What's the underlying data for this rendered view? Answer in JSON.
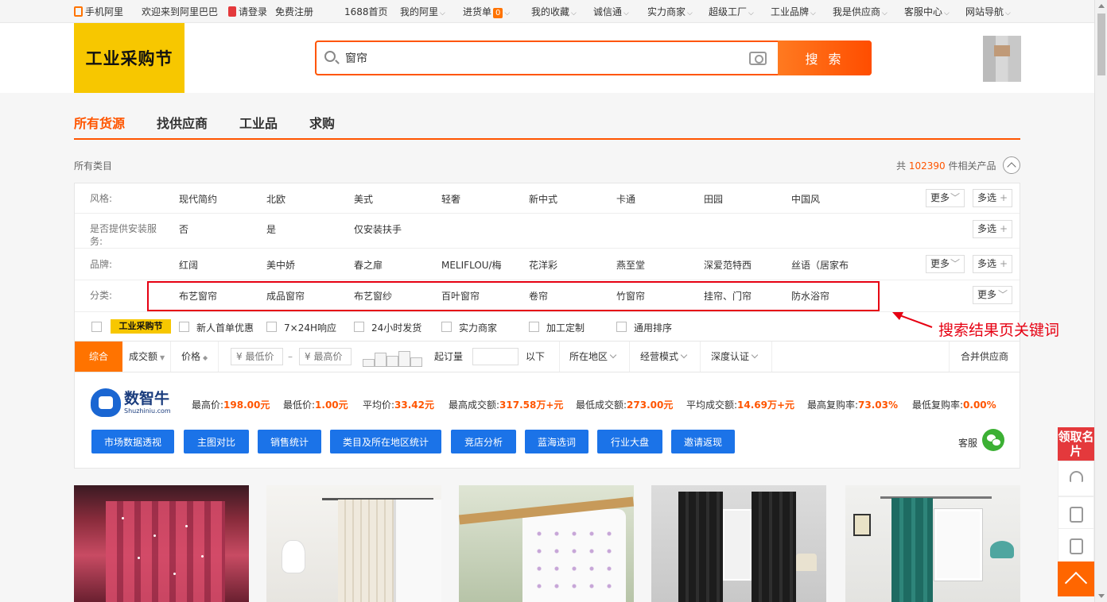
{
  "topbar": {
    "mobile": "手机阿里",
    "welcome": "欢迎来到阿里巴巴",
    "login": "请登录",
    "register": "免费注册",
    "home": "1688首页",
    "my_ali": "我的阿里",
    "cart": "进货单",
    "cart_count": "0",
    "favorites": "我的收藏",
    "trust": "诚信通",
    "power_merchant": "实力商家",
    "super_factory": "超级工厂",
    "industrial_brand": "工业品牌",
    "i_am_supplier": "我是供应商",
    "service": "客服中心",
    "site_nav": "网站导航"
  },
  "header": {
    "logo_text": "工业采购节",
    "search_value": "窗帘",
    "search_button": "搜 索"
  },
  "tabs": [
    {
      "label": "所有货源"
    },
    {
      "label": "找供应商"
    },
    {
      "label": "工业品"
    },
    {
      "label": "求购"
    }
  ],
  "all_categories": "所有类目",
  "result_count": {
    "prefix": "共",
    "num": "102390",
    "suffix": "件相关产品"
  },
  "filters": {
    "style": {
      "label": "风格:",
      "values": [
        "现代简约",
        "北欧",
        "美式",
        "轻奢",
        "新中式",
        "卡通",
        "田园",
        "中国风"
      ]
    },
    "install": {
      "label": "是否提供安装服务:",
      "values": [
        "否",
        "是",
        "仅安装扶手"
      ]
    },
    "brand": {
      "label": "品牌:",
      "values": [
        "红阔",
        "美中娇",
        "春之扉",
        "MELIFLOU/梅",
        "花洋彩",
        "燕至堂",
        "深爱范特西",
        "丝语（居家布"
      ]
    },
    "category": {
      "label": "分类:",
      "values": [
        "布艺窗帘",
        "成品窗帘",
        "布艺窗纱",
        "百叶窗帘",
        "卷帘",
        "竹窗帘",
        "挂帘、门帘",
        "防水浴帘"
      ]
    },
    "more": "更多",
    "multi": "多选"
  },
  "checks": {
    "badge": "工业采购节",
    "items": [
      "新人首单优惠",
      "7×24H响应",
      "24小时发货",
      "实力商家",
      "加工定制",
      "通用排序"
    ]
  },
  "sortbar": {
    "composite": "综合",
    "volume": "成交额",
    "price": "价格",
    "min_price": "¥ 最低价",
    "dash": "–",
    "max_price": "¥ 最高价",
    "moq": "起订量",
    "below": "以下",
    "location": "所在地区",
    "business_mode": "经营模式",
    "certification": "深度认证",
    "merge": "合并供应商"
  },
  "analytics": {
    "brand": "数智牛",
    "brand_sub": "Shuzhiniu.com",
    "stats": [
      {
        "label": "最高价:",
        "value": "198.00元"
      },
      {
        "label": "最低价:",
        "value": "1.00元"
      },
      {
        "label": "平均价:",
        "value": "33.42元"
      },
      {
        "label": "最高成交额:",
        "value": "317.58万+元"
      },
      {
        "label": "最低成交额:",
        "value": "273.00元"
      },
      {
        "label": "平均成交额:",
        "value": "14.69万+元"
      },
      {
        "label": "最高复购率:",
        "value": "73.03%"
      },
      {
        "label": "最低复购率:",
        "value": "0.00%"
      }
    ],
    "buttons": [
      "市场数据透视",
      "主图对比",
      "销售统计",
      "类目及所在地区统计",
      "竞店分析",
      "蓝海选词",
      "行业大盘",
      "邀请返现"
    ],
    "service": "客服"
  },
  "annotation": {
    "text": "搜索结果页关键词",
    "color": "#e60012"
  },
  "side": {
    "card": "领取名片"
  },
  "colors": {
    "accent": "#ff5500",
    "blue": "#1b73e8",
    "yellow": "#f7c700"
  }
}
